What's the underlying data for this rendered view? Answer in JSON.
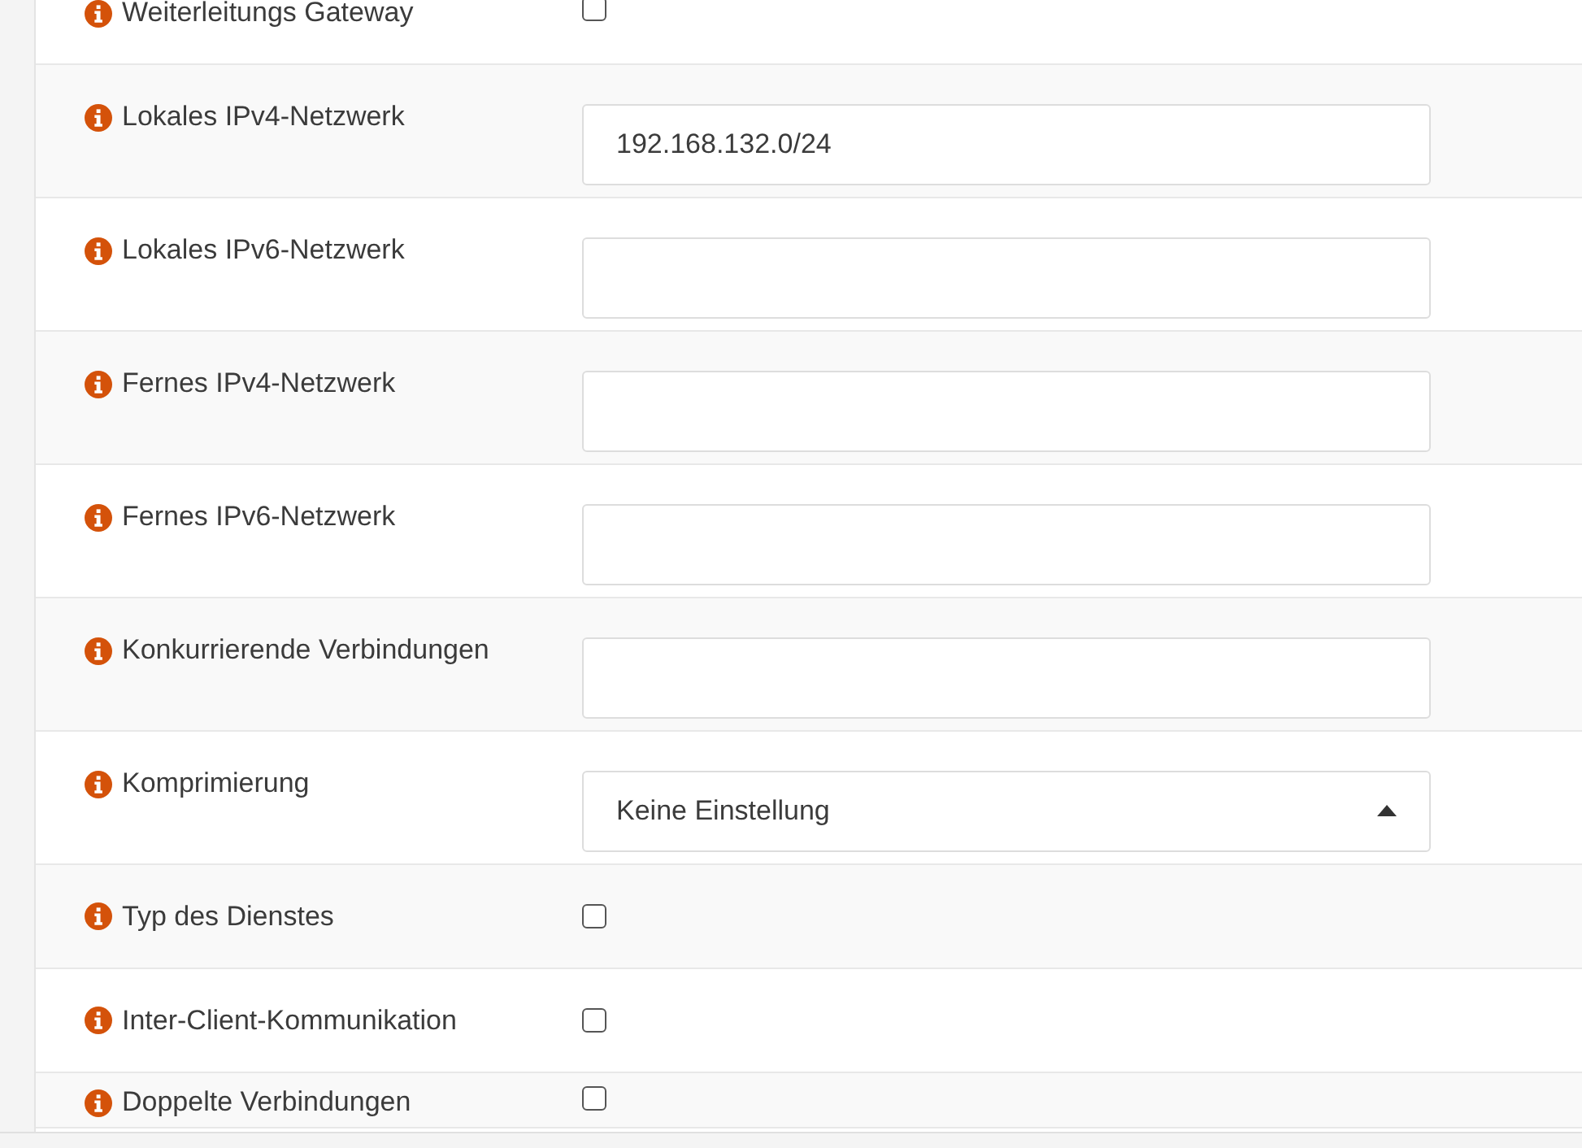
{
  "rows": [
    {
      "kind": "checkbox",
      "label": "Weiterleitungs Gateway",
      "checked": false
    },
    {
      "kind": "text",
      "label": "Lokales IPv4-Netzwerk",
      "value": "192.168.132.0/24"
    },
    {
      "kind": "text",
      "label": "Lokales IPv6-Netzwerk"
    },
    {
      "kind": "text",
      "label": "Fernes IPv4-Netzwerk"
    },
    {
      "kind": "text",
      "label": "Fernes IPv6-Netzwerk"
    },
    {
      "kind": "text",
      "label": "Konkurrierende Verbindungen"
    },
    {
      "kind": "select",
      "label": "Komprimierung",
      "value": "Keine Einstellung"
    },
    {
      "kind": "checkbox",
      "label": "Typ des Dienstes",
      "checked": false
    },
    {
      "kind": "checkbox",
      "label": "Inter-Client-Kommunikation",
      "checked": false
    },
    {
      "kind": "checkbox",
      "label": "Doppelte Verbindungen",
      "checked": false
    }
  ]
}
